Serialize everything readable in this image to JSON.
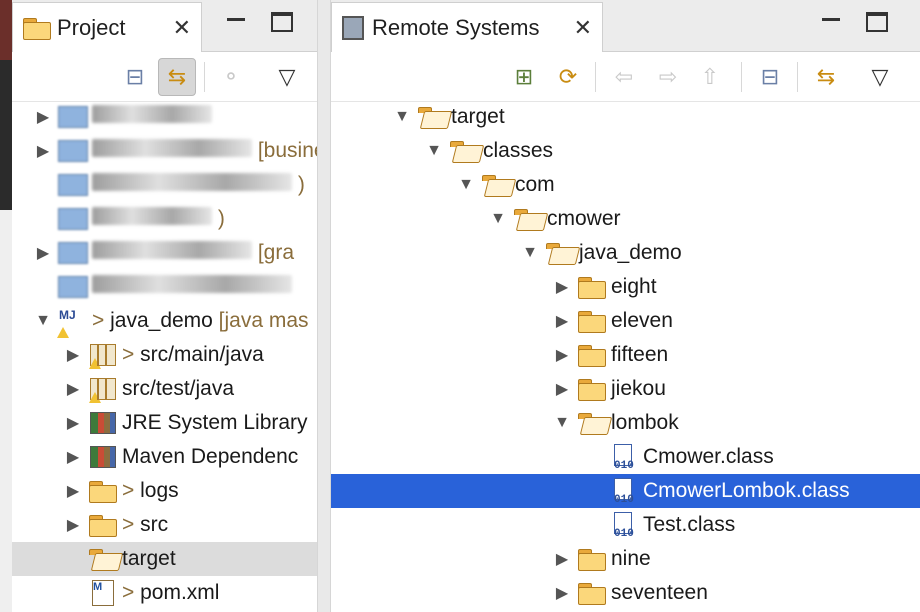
{
  "project_panel": {
    "tab_label": "Project",
    "tree": [
      {
        "label": "",
        "blurred": true,
        "twisty": "collapsed",
        "icon": "blurred-project-icon"
      },
      {
        "label": "",
        "blurred": true,
        "twisty": "collapsed",
        "icon": "blurred-project-icon",
        "suffix": "[business-ser"
      },
      {
        "label": "",
        "blurred": true,
        "twisty": "none",
        "icon": "blurred-project-icon",
        "suffix": ")"
      },
      {
        "label": "",
        "blurred": true,
        "twisty": "none",
        "icon": "blurred-project-icon",
        "suffix": ")"
      },
      {
        "label": "",
        "blurred": true,
        "twisty": "collapsed",
        "icon": "blurred-project-icon",
        "suffix": "[gra"
      },
      {
        "label": "",
        "blurred": true,
        "twisty": "none",
        "icon": "blurred-project-icon"
      },
      {
        "label": "java_demo",
        "prefix": ">",
        "suffix": "[java mas",
        "twisty": "expanded",
        "icon": "maven-java-project-icon"
      },
      {
        "label": "src/main/java",
        "prefix": ">",
        "twisty": "collapsed",
        "icon": "source-package-icon"
      },
      {
        "label": "src/test/java",
        "prefix": "",
        "twisty": "collapsed",
        "icon": "source-package-icon"
      },
      {
        "label": "JRE System Library",
        "prefix": "",
        "twisty": "collapsed",
        "icon": "library-icon"
      },
      {
        "label": "Maven Dependenc",
        "prefix": "",
        "twisty": "collapsed",
        "icon": "library-icon"
      },
      {
        "label": "logs",
        "prefix": ">",
        "twisty": "collapsed",
        "icon": "folder-icon"
      },
      {
        "label": "src",
        "prefix": ">",
        "twisty": "collapsed",
        "icon": "folder-icon"
      },
      {
        "label": "target",
        "prefix": "",
        "twisty": "none",
        "icon": "folder-open-icon",
        "selected": true
      },
      {
        "label": "pom.xml",
        "prefix": ">",
        "twisty": "none",
        "icon": "pom-file-icon"
      }
    ]
  },
  "remote_panel": {
    "tab_label": "Remote Systems",
    "tree": [
      {
        "label": "target",
        "twisty": "expanded",
        "icon": "folder-open-icon",
        "depth": 0
      },
      {
        "label": "classes",
        "twisty": "expanded",
        "icon": "folder-open-icon",
        "depth": 1
      },
      {
        "label": "com",
        "twisty": "expanded",
        "icon": "folder-open-icon",
        "depth": 2
      },
      {
        "label": "cmower",
        "twisty": "expanded",
        "icon": "folder-open-icon",
        "depth": 3
      },
      {
        "label": "java_demo",
        "twisty": "expanded",
        "icon": "folder-open-icon",
        "depth": 4
      },
      {
        "label": "eight",
        "twisty": "collapsed",
        "icon": "folder-icon",
        "depth": 5
      },
      {
        "label": "eleven",
        "twisty": "collapsed",
        "icon": "folder-icon",
        "depth": 5
      },
      {
        "label": "fifteen",
        "twisty": "collapsed",
        "icon": "folder-icon",
        "depth": 5
      },
      {
        "label": "jiekou",
        "twisty": "collapsed",
        "icon": "folder-icon",
        "depth": 5
      },
      {
        "label": "lombok",
        "twisty": "expanded",
        "icon": "folder-open-icon",
        "depth": 5
      },
      {
        "label": "Cmower.class",
        "twisty": "none",
        "icon": "class-file-icon",
        "depth": 6
      },
      {
        "label": "CmowerLombok.class",
        "twisty": "none",
        "icon": "class-file-icon",
        "depth": 6,
        "selected": true
      },
      {
        "label": "Test.class",
        "twisty": "none",
        "icon": "class-file-icon",
        "depth": 6
      },
      {
        "label": "nine",
        "twisty": "collapsed",
        "icon": "folder-icon",
        "depth": 5
      },
      {
        "label": "seventeen",
        "twisty": "collapsed",
        "icon": "folder-icon",
        "depth": 5
      }
    ]
  },
  "glyphs": {
    "close": "✕",
    "twisty_collapsed": "▶",
    "twisty_expanded": "▼",
    "view_menu": "▽",
    "collapse_all": "⊟",
    "link_editor": "⇆",
    "focus": "⚬",
    "back": "⇦",
    "forward": "⇨",
    "up": "⇧",
    "new_connection": "⊞",
    "refresh": "⟳"
  },
  "colors": {
    "selection_blue": "#2962d9",
    "selection_gray": "#dcdcdc",
    "decoration": "#8a6d3b"
  }
}
